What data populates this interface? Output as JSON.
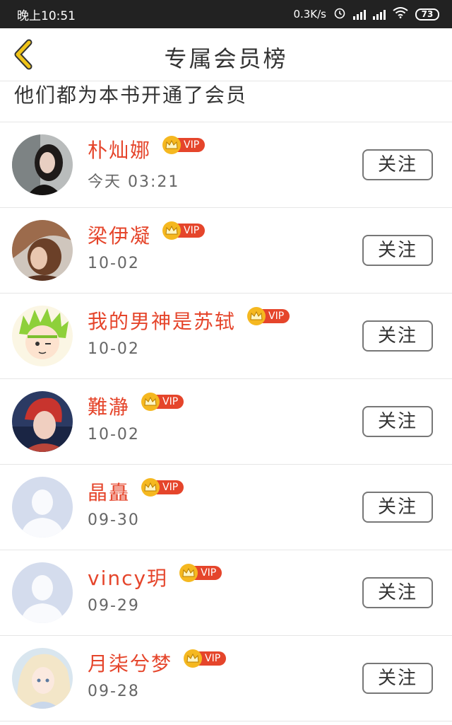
{
  "status_bar": {
    "time": "晚上10:51",
    "network_speed": "0.3K/s",
    "battery": "73",
    "icons": [
      "alarm-icon",
      "hd-signal-icon",
      "signal-icon",
      "wifi-icon",
      "battery-icon"
    ]
  },
  "header": {
    "back_icon": "chevron-left-icon",
    "title": "专属会员榜"
  },
  "subheader": {
    "text": "他们都为本书开通了会员"
  },
  "colors": {
    "name": "#e5452b",
    "vip_badge": "#e5452b",
    "crown": "#f5b820",
    "back_arrow": "#f0c419"
  },
  "members": [
    {
      "name": "朴灿娜",
      "badge": "VIP",
      "date": "今天 03:21",
      "follow_label": "关注",
      "avatar": "photo-woman-dark-hair"
    },
    {
      "name": "梁伊凝",
      "badge": "VIP",
      "date": "10-02",
      "follow_label": "关注",
      "avatar": "photo-woman-profile"
    },
    {
      "name": "我的男神是苏轼",
      "badge": "VIP",
      "date": "10-02",
      "follow_label": "关注",
      "avatar": "anime-green-hair"
    },
    {
      "name": "難瀞",
      "badge": "VIP",
      "date": "10-02",
      "follow_label": "关注",
      "avatar": "photo-man-red-hair"
    },
    {
      "name": "晶矗",
      "badge": "VIP",
      "date": "09-30",
      "follow_label": "关注",
      "avatar": "default-user"
    },
    {
      "name": "vincy玥",
      "badge": "VIP",
      "date": "09-29",
      "follow_label": "关注",
      "avatar": "default-user"
    },
    {
      "name": "月柒兮梦",
      "badge": "VIP",
      "date": "09-28",
      "follow_label": "关注",
      "avatar": "anime-girl-pastel"
    }
  ]
}
